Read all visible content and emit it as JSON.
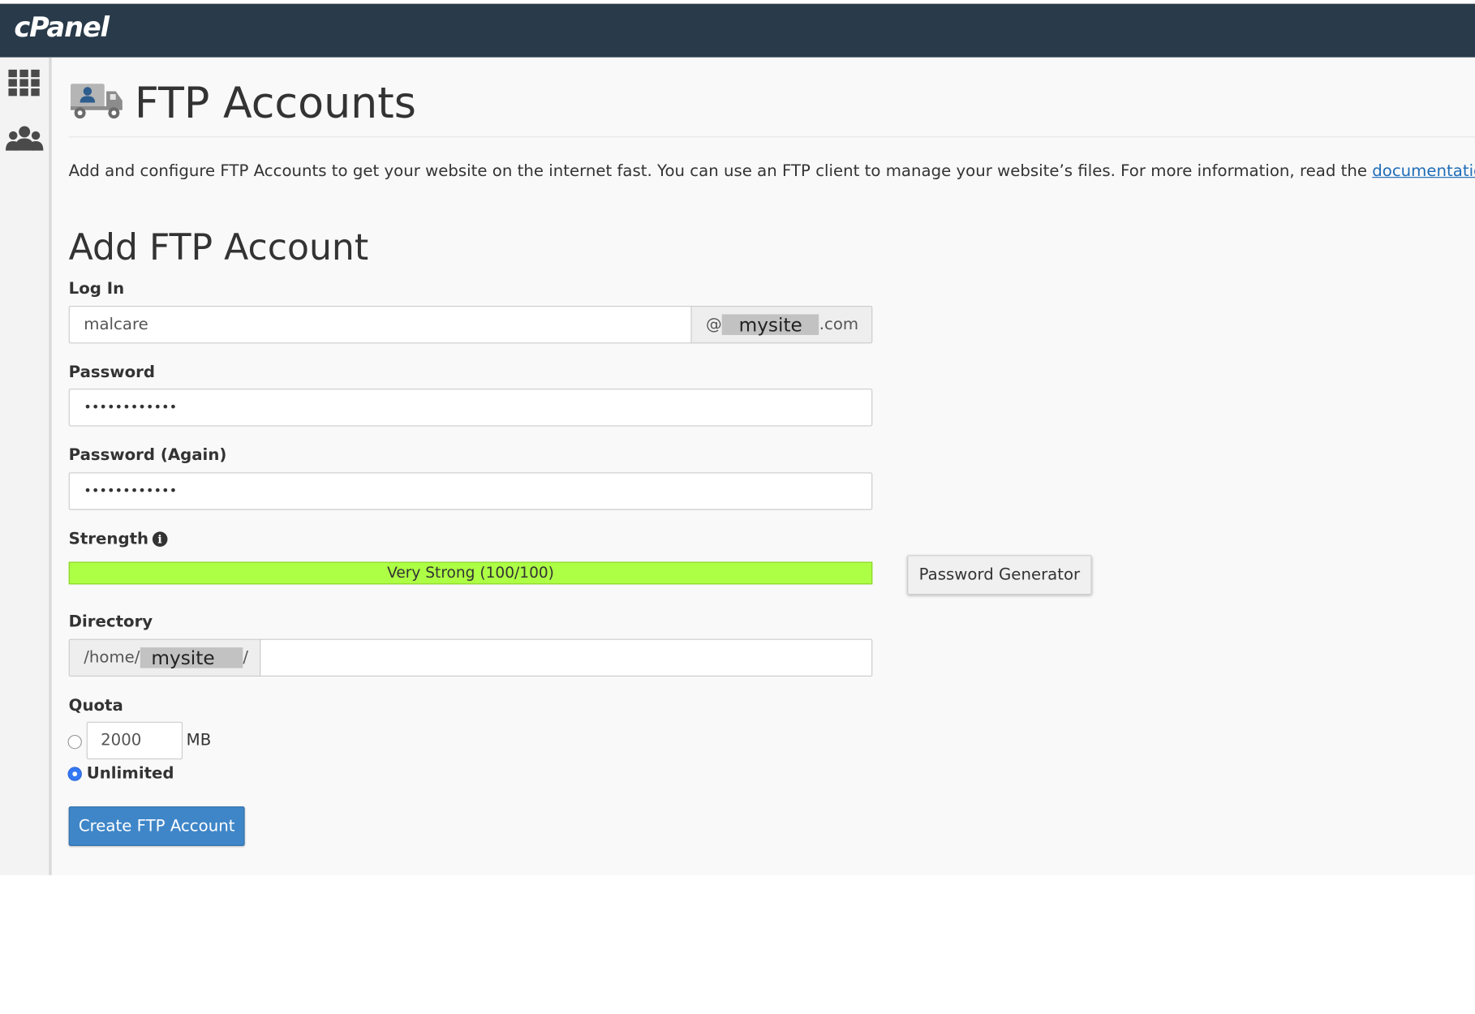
{
  "app": {
    "logo": "cPanel"
  },
  "sidebar": {
    "items": [
      {
        "name": "apps-grid-icon"
      },
      {
        "name": "users-icon"
      }
    ]
  },
  "page": {
    "title": "FTP Accounts",
    "intro_text": "Add and configure FTP Accounts to get your website on the internet fast. You can use an FTP client to manage your website’s files. For more information, read the ",
    "intro_link": "documentation",
    "intro_end": "."
  },
  "form": {
    "section_title": "Add FTP Account",
    "login": {
      "label": "Log In",
      "value": "malcare",
      "domain_prefix": "@",
      "domain_redacted": "mysite",
      "domain_suffix": ".com"
    },
    "password": {
      "label": "Password",
      "masked": "••••••••••••"
    },
    "password_again": {
      "label": "Password (Again)",
      "masked": "••••••••••••"
    },
    "strength": {
      "label": "Strength",
      "info_glyph": "i",
      "text": "Very Strong (100/100)",
      "score": 100,
      "bar_color": "#adff45"
    },
    "password_generator_label": "Password Generator",
    "directory": {
      "label": "Directory",
      "prefix": "/home/",
      "redacted": "mysite",
      "suffix": "/",
      "value": ""
    },
    "quota": {
      "label": "Quota",
      "value": "2000",
      "unit": "MB",
      "unlimited_label": "Unlimited",
      "selected": "unlimited"
    },
    "submit_label": "Create FTP Account"
  },
  "colors": {
    "topbar": "#293a4a",
    "accent": "#3f86c8",
    "link": "#1f6db8"
  }
}
